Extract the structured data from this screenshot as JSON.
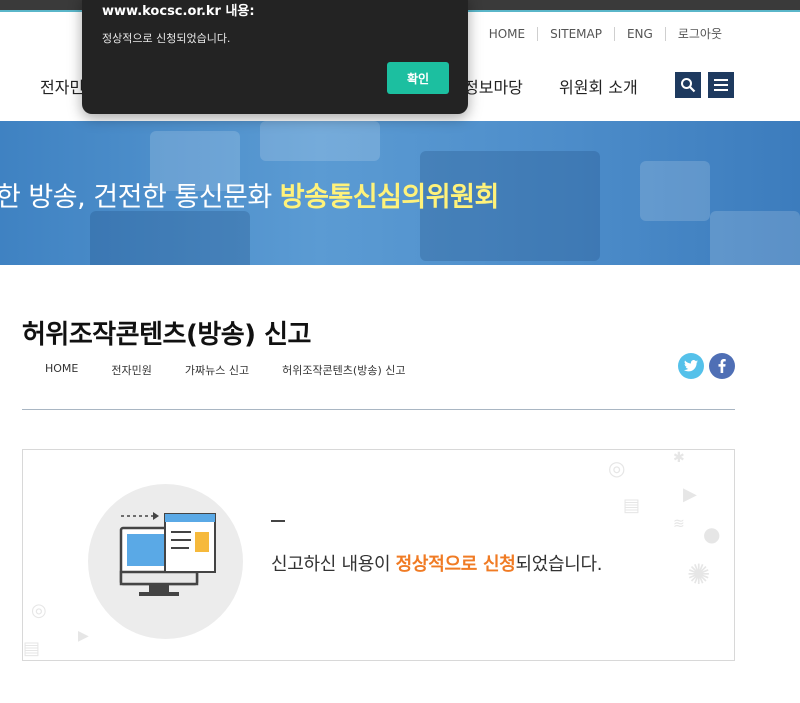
{
  "util_nav": [
    "HOME",
    "SITEMAP",
    "ENG",
    "로그아웃"
  ],
  "gnb": {
    "item1": "전자민",
    "item2": "정보마당",
    "item3": "위원회 소개"
  },
  "hero": {
    "text": "한 방송, 건전한 통신문화",
    "accent": "방송통신심의위원회"
  },
  "page": {
    "title": "허위조작콘텐츠(방송) 신고",
    "breadcrumb": [
      "HOME",
      "전자민원",
      "가짜뉴스 신고",
      "허위조작콘텐츠(방송) 신고"
    ]
  },
  "result": {
    "dash": "—",
    "msg_pre": "신고하신 내용이 ",
    "msg_hl": "정상적으로 신청",
    "msg_post": "되었습니다."
  },
  "dialog": {
    "title": "www.kocsc.or.kr 내용:",
    "message": "정상적으로 신청되었습니다.",
    "ok_label": "확인"
  },
  "colors": {
    "accent_yellow": "#fff27a",
    "highlight_orange": "#f07b24",
    "ok_button": "#1cbfa0",
    "nav_button": "#1e3a5f"
  }
}
